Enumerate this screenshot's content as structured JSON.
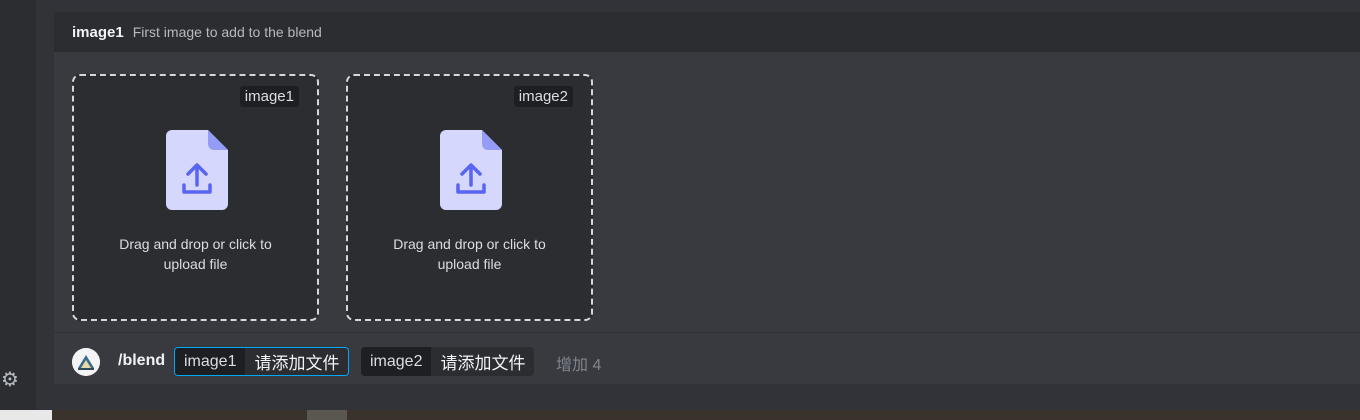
{
  "option_header": {
    "name": "image1",
    "description": "First image to add to the blend"
  },
  "dropzones": [
    {
      "tag": "image1",
      "line1": "Drag and drop or click to",
      "line2": "upload file"
    },
    {
      "tag": "image2",
      "line1": "Drag and drop or click to",
      "line2": "upload file"
    }
  ],
  "command_bar": {
    "command": "/blend",
    "options": [
      {
        "name": "image1",
        "value": "请添加文件",
        "active": true
      },
      {
        "name": "image2",
        "value": "请添加文件",
        "active": false
      }
    ],
    "more_label": "增加 4"
  },
  "icons": {
    "settings": "gear-icon",
    "upload": "file-upload-icon",
    "avatar": "bot-avatar"
  },
  "colors": {
    "accent": "#5865f2",
    "active_border": "#00a8fc",
    "file_icon_bg": "#d5d7fc"
  }
}
